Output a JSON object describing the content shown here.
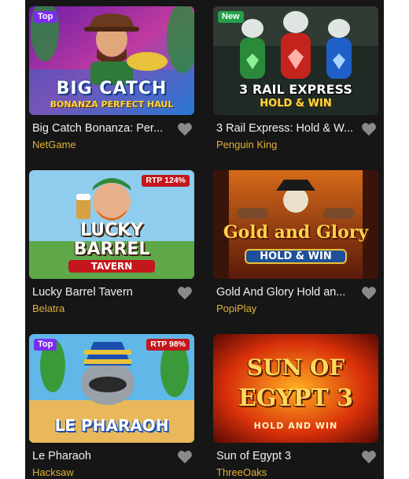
{
  "games": [
    {
      "title": "Big Catch Bonanza: Per...",
      "provider": "NetGame",
      "badge": "Top",
      "rtp": "",
      "art_line1": "BIG CATCH",
      "art_line2": "BONANZA PERFECT HAUL",
      "art_line3": ""
    },
    {
      "title": "3 Rail Express: Hold & W...",
      "provider": "Penguin King",
      "badge": "New",
      "rtp": "",
      "art_line1": "3 RAIL EXPRESS",
      "art_line2": "HOLD & WIN",
      "art_line3": ""
    },
    {
      "title": "Lucky Barrel Tavern",
      "provider": "Belatra",
      "badge": "",
      "rtp": "RTP 124%",
      "art_line1": "LUCKY",
      "art_line2": "BARREL",
      "art_line3": "TAVERN"
    },
    {
      "title": "Gold And Glory Hold an...",
      "provider": "PopiPlay",
      "badge": "",
      "rtp": "",
      "art_line1": "Gold and Glory",
      "art_line2": "HOLD & WIN",
      "art_line3": ""
    },
    {
      "title": "Le Pharaoh",
      "provider": "Hacksaw",
      "badge": "Top",
      "rtp": "RTP 98%",
      "art_line1": "LE PHARAOH",
      "art_line2": "",
      "art_line3": ""
    },
    {
      "title": "Sun of Egypt 3",
      "provider": "ThreeOaks",
      "badge": "",
      "rtp": "",
      "art_line1": "SUN OF",
      "art_line2": "EGYPT 3",
      "art_line3": "HOLD AND WIN"
    }
  ],
  "colors": {
    "top_badge": "#7b2cf0",
    "new_badge": "#22a04a",
    "rtp_badge": "#c4161c",
    "provider_text": "#e0b23a",
    "panel_bg": "#161616"
  },
  "icons": {
    "favorite": "heart-icon"
  }
}
